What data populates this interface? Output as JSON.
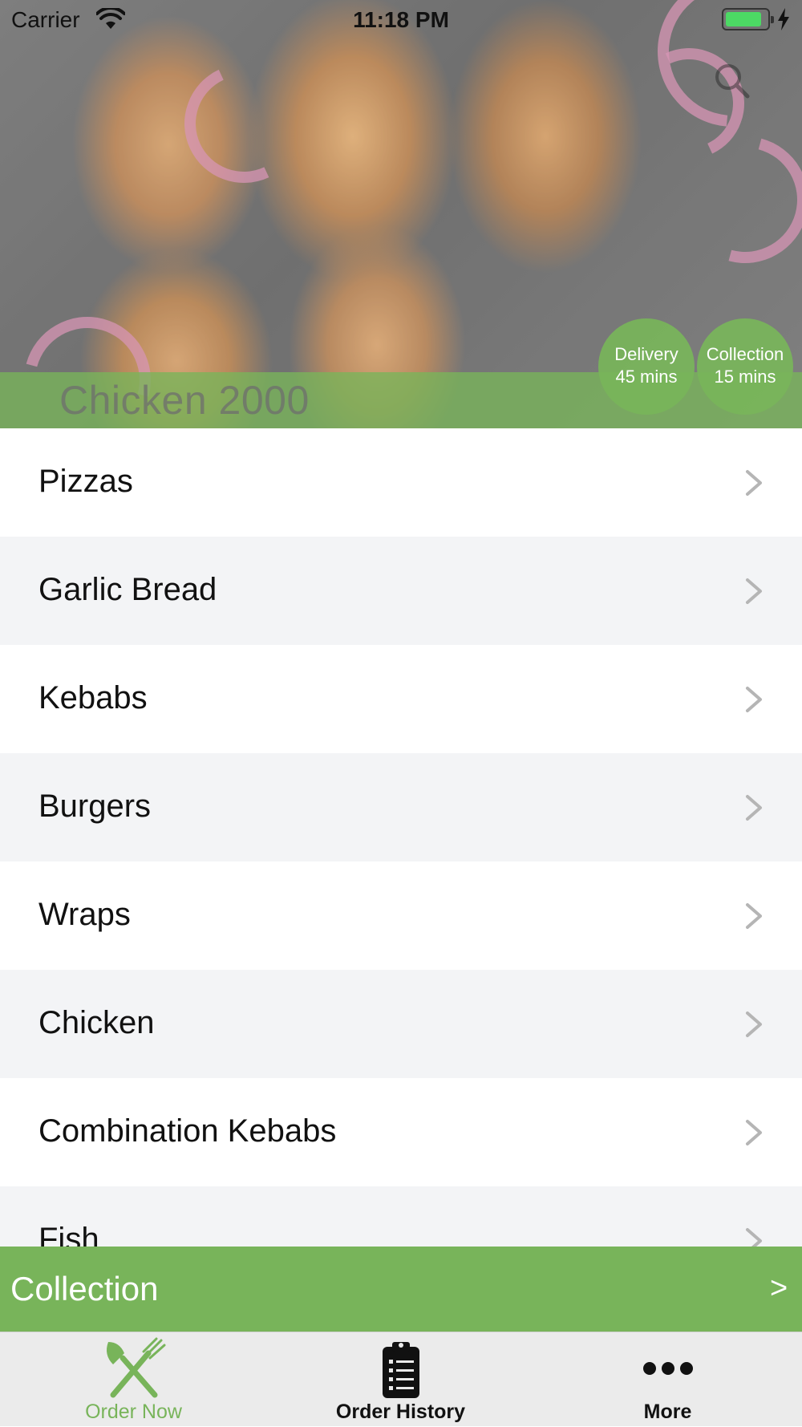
{
  "status_bar": {
    "carrier": "Carrier",
    "time": "11:18 PM"
  },
  "hero": {
    "restaurant_name": "Chicken 2000",
    "delivery": {
      "label": "Delivery",
      "time": "45 mins"
    },
    "collection": {
      "label": "Collection",
      "time": "15 mins"
    }
  },
  "menu": {
    "categories": [
      {
        "label": "Pizzas"
      },
      {
        "label": "Garlic Bread"
      },
      {
        "label": "Kebabs"
      },
      {
        "label": "Burgers"
      },
      {
        "label": "Wraps"
      },
      {
        "label": "Chicken"
      },
      {
        "label": "Combination Kebabs"
      },
      {
        "label": "Fish"
      }
    ]
  },
  "order_bar": {
    "mode_label": "Collection",
    "arrow": ">"
  },
  "tab_bar": {
    "tabs": [
      {
        "label": "Order Now",
        "icon": "fork-knife-icon",
        "active": true
      },
      {
        "label": "Order History",
        "icon": "clipboard-list-icon",
        "active": false
      },
      {
        "label": "More",
        "icon": "more-dots-icon",
        "active": false
      }
    ]
  },
  "colors": {
    "accent_green": "#78b45a",
    "row_alt": "#f3f4f6"
  }
}
